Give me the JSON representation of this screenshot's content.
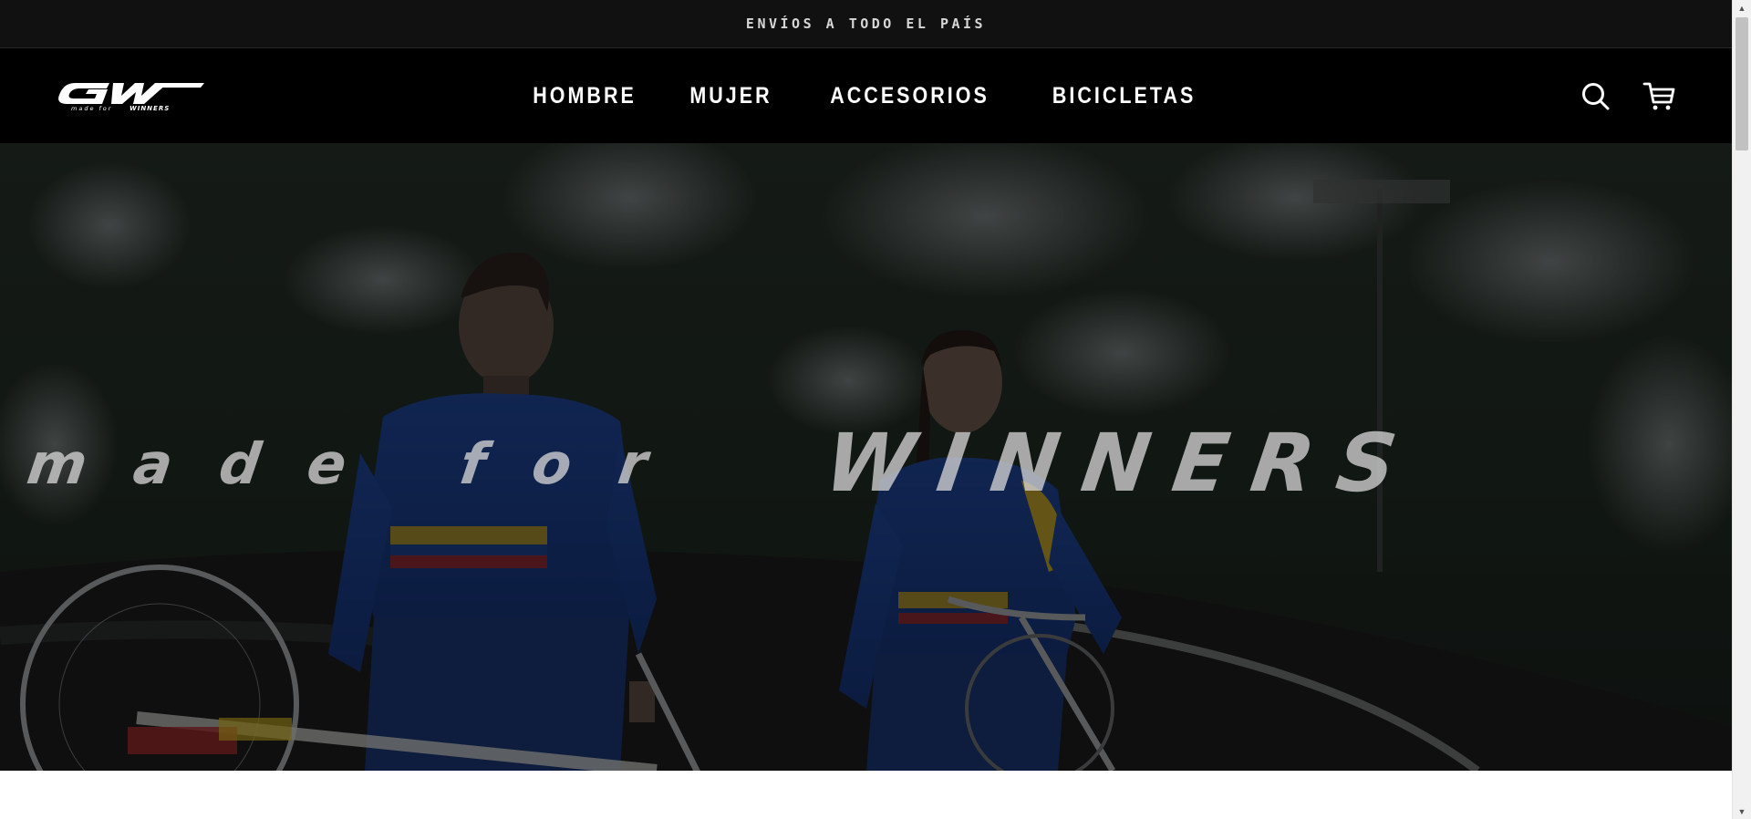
{
  "announcement": {
    "text": "ENVÍOS A TODO EL PAÍS"
  },
  "header": {
    "logo": {
      "text": "GW",
      "tagline": "made for WINNERS"
    },
    "nav": [
      {
        "label": "HOMBRE"
      },
      {
        "label": "MUJER"
      },
      {
        "label": "ACCESORIOS"
      },
      {
        "label": "BICICLETAS"
      }
    ],
    "icons": {
      "search": "search-icon",
      "cart": "cart-icon"
    }
  },
  "hero": {
    "headline_left": "made for",
    "headline_right": "WINNERS",
    "description": "Two BMX riders in blue Colombia team jerseys standing with bikes on a track, dark overlay"
  },
  "colors": {
    "announce_bg": "#111111",
    "header_bg": "#000000",
    "jersey_blue": "#1d3f86",
    "stripe_yellow": "#d9b21b",
    "stripe_red": "#b52a2a"
  },
  "scrollbar": {
    "position": 0.02
  }
}
